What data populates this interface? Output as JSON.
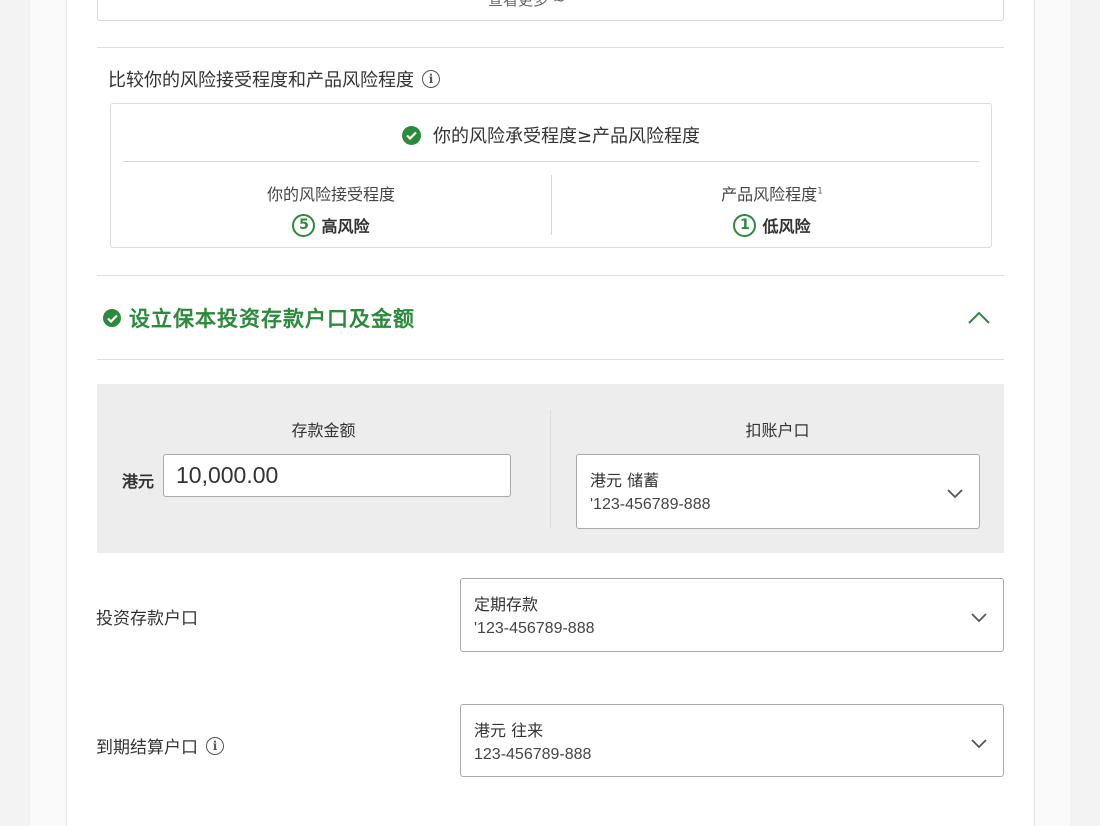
{
  "top_box_text": "查看更多 ~",
  "comparison": {
    "title": "比较你的风险接受程度和产品风险程度",
    "result": "你的风险承受程度≥产品风险程度",
    "customer": {
      "label": "你的风险接受程度",
      "level": "5",
      "level_text": "高风险"
    },
    "product": {
      "label": "产品风险程度",
      "footnote": "1",
      "level": "1",
      "level_text": "低风险"
    }
  },
  "section": {
    "title": "设立保本投资存款户口及金额"
  },
  "deposit": {
    "amount_label": "存款金额",
    "currency": "港元",
    "amount_value": "10,000.00",
    "debit_label": "扣账户口",
    "debit_account_name": "港元 储蓄",
    "debit_account_number": "'123-456789-888"
  },
  "investment_account": {
    "label": "投资存款户口",
    "name": "定期存款",
    "number": "'123-456789-888"
  },
  "settlement_account": {
    "label": "到期结算户口",
    "name": "港元 往来",
    "number": "123-456789-888"
  },
  "colors": {
    "accent_green": "#2c8a3c",
    "panel_grey": "#ededed"
  }
}
